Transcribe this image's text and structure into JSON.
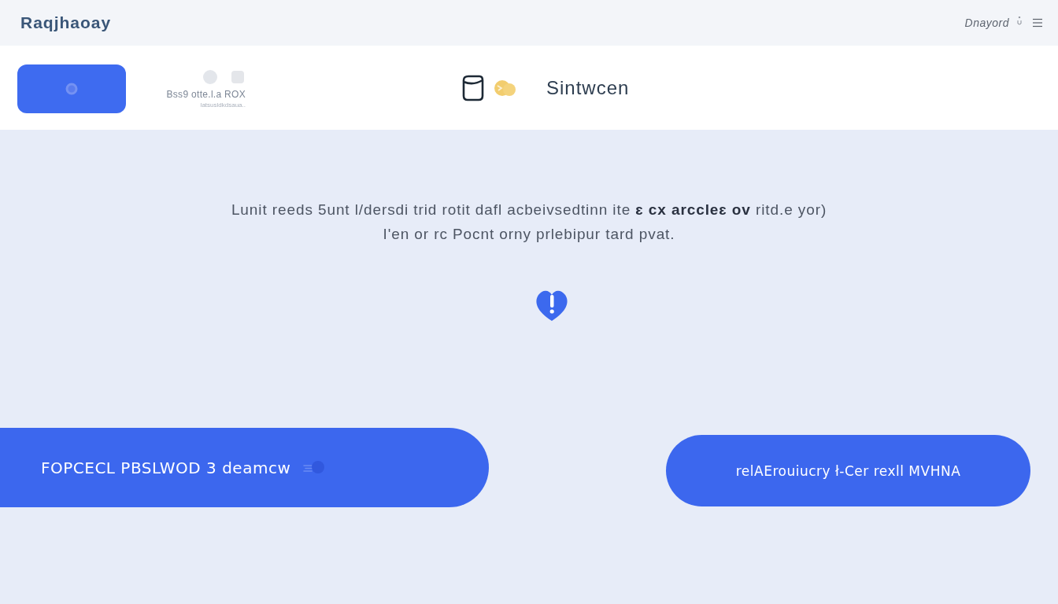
{
  "top_bar": {
    "logo": "Raqjhaoay",
    "user_name": "Dnayord"
  },
  "header": {
    "status": {
      "title": "Bss9 otte.l.a ROX",
      "subtitle": "latsusldkdsaua.."
    },
    "brand": {
      "name": "Sintwcen"
    }
  },
  "message": {
    "lines": [
      "Lunit reeds 5unt l/dersdi trid rotit dafl  acbeivsedtinn ite **ɛ cx arccleɛ ov** ritd.e yor)",
      "I'en  or rc Pocnt orny prlebipur tard pvat."
    ]
  },
  "buttons": [
    {
      "kind": "wide",
      "label": "FOPCECL PBSLWOD 3  deamcw"
    },
    {
      "kind": "pill",
      "label": "relAErouiucry ł-Cer rexll MVHNA"
    }
  ]
}
